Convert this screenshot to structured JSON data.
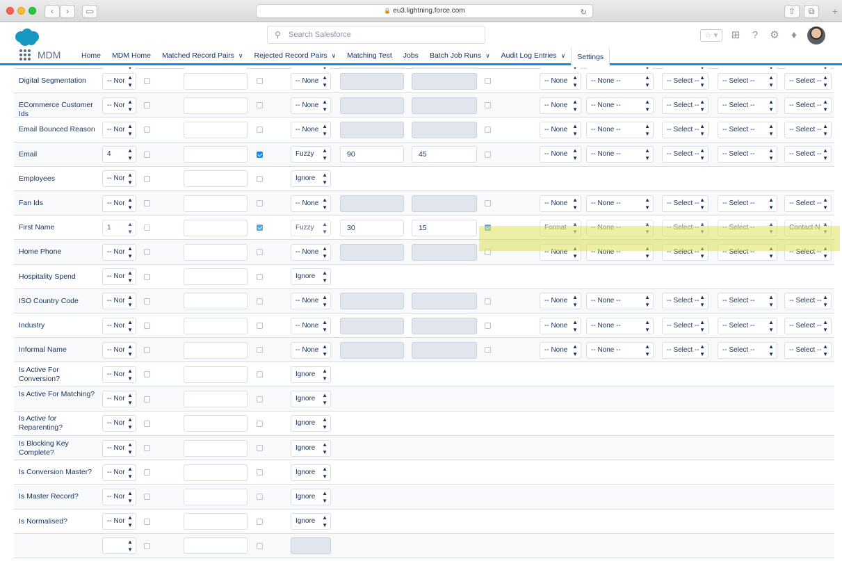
{
  "browser": {
    "url": "eu3.lightning.force.com"
  },
  "header": {
    "search_placeholder": "Search Salesforce"
  },
  "nav": {
    "app_name": "MDM",
    "items": [
      {
        "label": "Home",
        "dropdown": false
      },
      {
        "label": "MDM Home",
        "dropdown": false
      },
      {
        "label": "Matched Record Pairs",
        "dropdown": true
      },
      {
        "label": "Rejected Record Pairs",
        "dropdown": true
      },
      {
        "label": "Matching Test",
        "dropdown": false
      },
      {
        "label": "Jobs",
        "dropdown": false
      },
      {
        "label": "Batch Job Runs",
        "dropdown": true
      },
      {
        "label": "Audit Log Entries",
        "dropdown": true
      },
      {
        "label": "Settings",
        "dropdown": false,
        "active": true
      }
    ]
  },
  "rows": [
    {
      "label": "",
      "order": "",
      "check1": false,
      "text": "",
      "check2": false,
      "method": "-- None",
      "threshold": "",
      "weight": "",
      "check3": false,
      "format": "-- None",
      "field1": "-- None --",
      "s1": "-- Select --",
      "s2": "-- Select --",
      "s3": "-- Select --",
      "type": "partial"
    },
    {
      "label": "Digital Segmentation",
      "order": "-- Nor",
      "check1": false,
      "text": "",
      "check2": false,
      "method": "-- None",
      "threshold": "",
      "weight": "",
      "check3": false,
      "format": "-- None",
      "field1": "-- None --",
      "s1": "-- Select --",
      "s2": "-- Select --",
      "s3": "-- Select --",
      "type": "full"
    },
    {
      "label": "ECommerce Customer Ids",
      "order": "-- Nor",
      "check1": false,
      "text": "",
      "check2": false,
      "method": "-- None",
      "threshold": "",
      "weight": "",
      "check3": false,
      "format": "-- None",
      "field1": "-- None --",
      "s1": "-- Select --",
      "s2": "-- Select --",
      "s3": "-- Select --",
      "type": "full"
    },
    {
      "label": "Email Bounced Reason",
      "order": "-- Nor",
      "check1": false,
      "text": "",
      "check2": false,
      "method": "-- None",
      "threshold": "",
      "weight": "",
      "check3": false,
      "format": "-- None",
      "field1": "-- None --",
      "s1": "-- Select --",
      "s2": "-- Select --",
      "s3": "-- Select --",
      "type": "full"
    },
    {
      "label": "Email",
      "order": "4",
      "check1": false,
      "text": "",
      "check2": true,
      "method": "Fuzzy",
      "threshold": "90",
      "weight": "45",
      "check3": false,
      "format": "-- None",
      "field1": "-- None --",
      "s1": "-- Select --",
      "s2": "-- Select --",
      "s3": "-- Select --",
      "type": "active"
    },
    {
      "label": "Employees",
      "order": "-- Nor",
      "check1": false,
      "text": "",
      "check2": false,
      "method": "Ignore",
      "type": "ignore"
    },
    {
      "label": "Fan Ids",
      "order": "-- Nor",
      "check1": false,
      "text": "",
      "check2": false,
      "method": "-- None",
      "threshold": "",
      "weight": "",
      "check3": false,
      "format": "-- None",
      "field1": "-- None --",
      "s1": "-- Select --",
      "s2": "-- Select --",
      "s3": "-- Select --",
      "type": "full"
    },
    {
      "label": "First Name",
      "order": "1",
      "check1": false,
      "text": "",
      "check2": true,
      "method": "Fuzzy",
      "threshold": "30",
      "weight": "15",
      "check3": true,
      "format": "Format",
      "field1": "-- None --",
      "s1": "-- Select --",
      "s2": "-- Select --",
      "s3": "Contact N",
      "type": "active",
      "highlight": true
    },
    {
      "label": "Home Phone",
      "order": "-- Nor",
      "check1": false,
      "text": "",
      "check2": false,
      "method": "-- None",
      "threshold": "",
      "weight": "",
      "check3": false,
      "format": "-- None",
      "field1": "-- None --",
      "s1": "-- Select --",
      "s2": "-- Select --",
      "s3": "-- Select --",
      "type": "full"
    },
    {
      "label": "Hospitality Spend",
      "order": "-- Nor",
      "check1": false,
      "text": "",
      "check2": false,
      "method": "Ignore",
      "type": "ignore"
    },
    {
      "label": "ISO Country Code",
      "order": "-- Nor",
      "check1": false,
      "text": "",
      "check2": false,
      "method": "-- None",
      "threshold": "",
      "weight": "",
      "check3": false,
      "format": "-- None",
      "field1": "-- None --",
      "s1": "-- Select --",
      "s2": "-- Select --",
      "s3": "-- Select --",
      "type": "full"
    },
    {
      "label": "Industry",
      "order": "-- Nor",
      "check1": false,
      "text": "",
      "check2": false,
      "method": "-- None",
      "threshold": "",
      "weight": "",
      "check3": false,
      "format": "-- None",
      "field1": "-- None --",
      "s1": "-- Select --",
      "s2": "-- Select --",
      "s3": "-- Select --",
      "type": "full"
    },
    {
      "label": "Informal Name",
      "order": "-- Nor",
      "check1": false,
      "text": "",
      "check2": false,
      "method": "-- None",
      "threshold": "",
      "weight": "",
      "check3": false,
      "format": "-- None",
      "field1": "-- None --",
      "s1": "-- Select --",
      "s2": "-- Select --",
      "s3": "-- Select --",
      "type": "full"
    },
    {
      "label": "Is Active For Conversion?",
      "order": "-- Nor",
      "check1": false,
      "text": "",
      "check2": false,
      "method": "Ignore",
      "type": "ignore"
    },
    {
      "label": "Is Active For Matching?",
      "order": "-- Nor",
      "check1": false,
      "text": "",
      "check2": false,
      "method": "Ignore",
      "type": "ignore"
    },
    {
      "label": "Is Active for Reparenting?",
      "order": "-- Nor",
      "check1": false,
      "text": "",
      "check2": false,
      "method": "Ignore",
      "type": "ignore"
    },
    {
      "label": "Is Blocking Key Complete?",
      "order": "-- Nor",
      "check1": false,
      "text": "",
      "check2": false,
      "method": "Ignore",
      "type": "ignore"
    },
    {
      "label": "Is Conversion Master?",
      "order": "-- Nor",
      "check1": false,
      "text": "",
      "check2": false,
      "method": "Ignore",
      "type": "ignore"
    },
    {
      "label": "Is Master Record?",
      "order": "-- Nor",
      "check1": false,
      "text": "",
      "check2": false,
      "method": "Ignore",
      "type": "ignore"
    },
    {
      "label": "Is Normalised?",
      "order": "-- Nor",
      "check1": false,
      "text": "",
      "check2": false,
      "method": "Ignore",
      "type": "ignore"
    },
    {
      "label": "",
      "order": "",
      "check1": false,
      "text": "",
      "check2": false,
      "method": "",
      "type": "partial-bottom"
    }
  ]
}
